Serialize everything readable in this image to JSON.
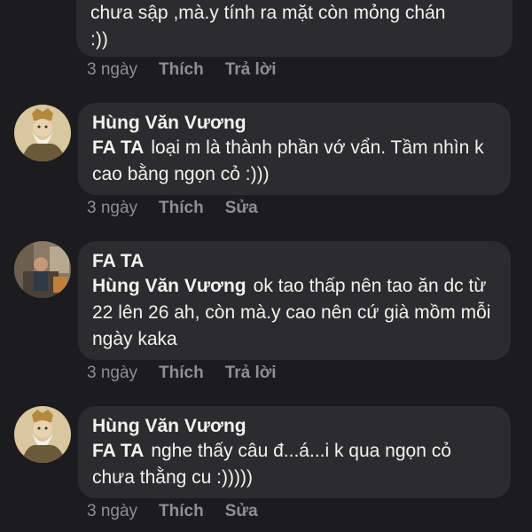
{
  "comments": [
    {
      "text": "chưa sập ,mà.y tính ra mặt còn mỏng chán :))",
      "time": "3 ngày",
      "like": "Thích",
      "action": "Trả lời"
    },
    {
      "author": "Hùng Văn Vương",
      "mention": "FA TA",
      "text": "loại m là thành phần vớ vẩn. Tầm nhìn k cao bằng ngọn cỏ :)))",
      "time": "3 ngày",
      "like": "Thích",
      "action": "Sửa"
    },
    {
      "author": "FA TA",
      "mention": "Hùng Văn Vương",
      "text": "ok tao thấp nên tao ăn dc từ 22 lên 26 ah, còn mà.y cao nên cứ già mồm mỗi ngày kaka",
      "time": "3 ngày",
      "like": "Thích",
      "action": "Trả lời"
    },
    {
      "author": "Hùng Văn Vương",
      "mention": "FA TA",
      "text": "nghe thấy câu đ...á...i  k qua ngọn cỏ chưa thằng cu :)))))",
      "time": "3 ngày",
      "like": "Thích",
      "action": "Sửa"
    }
  ]
}
